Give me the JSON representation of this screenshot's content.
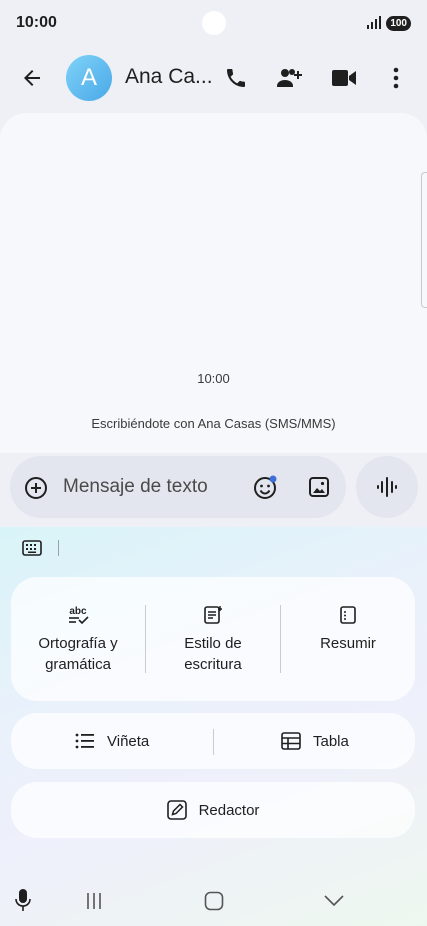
{
  "status_bar": {
    "time": "10:00",
    "battery": "100",
    "icons": [
      "signal-icon",
      "battery-icon"
    ]
  },
  "app_bar": {
    "avatar_letter": "A",
    "contact_name": "Ana Ca...",
    "icons": [
      "back-arrow-icon",
      "phone-icon",
      "add-contact-icon",
      "video-call-icon",
      "more-vert-icon"
    ]
  },
  "conversation": {
    "timestamp": "10:00",
    "info": "Escribiéndote con Ana Casas (SMS/MMS)"
  },
  "composer": {
    "placeholder": "Mensaje de texto",
    "icons": [
      "add-circle-icon",
      "emoji-icon",
      "gallery-icon",
      "voice-wave-icon"
    ]
  },
  "assistant": {
    "tools": [
      {
        "label": "Ortografía y\ngramática",
        "icon": "spellcheck-icon"
      },
      {
        "label": "Estilo de\nescritura",
        "icon": "writing-style-icon"
      },
      {
        "label": "Resumir",
        "icon": "summary-icon"
      }
    ],
    "format": [
      {
        "label": "Viñeta",
        "icon": "bullet-list-icon"
      },
      {
        "label": "Tabla",
        "icon": "table-icon"
      }
    ],
    "redactor": {
      "label": "Redactor",
      "icon": "compose-icon"
    }
  },
  "nav_bar": {
    "icons": [
      "mic-icon",
      "recents-icon",
      "home-icon",
      "collapse-keyboard-icon"
    ]
  }
}
